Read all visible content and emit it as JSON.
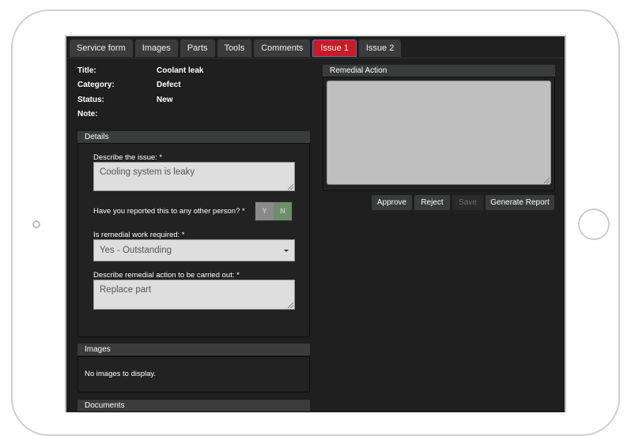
{
  "tabs": [
    {
      "label": "Service form",
      "active": false
    },
    {
      "label": "Images",
      "active": false
    },
    {
      "label": "Parts",
      "active": false
    },
    {
      "label": "Tools",
      "active": false
    },
    {
      "label": "Comments",
      "active": false
    },
    {
      "label": "Issue 1",
      "active": true
    },
    {
      "label": "Issue 2",
      "active": false
    }
  ],
  "info": {
    "title_label": "Title:",
    "title_value": "Coolant leak",
    "category_label": "Category:",
    "category_value": "Defect",
    "status_label": "Status:",
    "status_value": "New",
    "note_label": "Note:",
    "note_value": ""
  },
  "details": {
    "heading": "Details",
    "describe_label": "Describe the issue: *",
    "describe_value": "Cooling system is leaky",
    "reported_label": "Have you reported this to any other person? *",
    "reported_yes": "Y",
    "reported_no": "N",
    "reported_value": "N",
    "remedial_required_label": "Is remedial work required: *",
    "remedial_required_value": "Yes - Outstanding",
    "remedial_action_label": "Describe remedial action to be carried out: *",
    "remedial_action_value": "Replace part"
  },
  "images": {
    "heading": "Images",
    "empty_text": "No images to display."
  },
  "documents": {
    "heading": "Documents"
  },
  "remedial_panel": {
    "heading": "Remedial Action",
    "value": ""
  },
  "actions": {
    "approve": "Approve",
    "reject": "Reject",
    "save": "Save",
    "generate_report": "Generate Report"
  },
  "colors": {
    "active_tab": "#c51c25",
    "toggle_selected": "#6d8f6a",
    "background": "#1f1f1f"
  }
}
